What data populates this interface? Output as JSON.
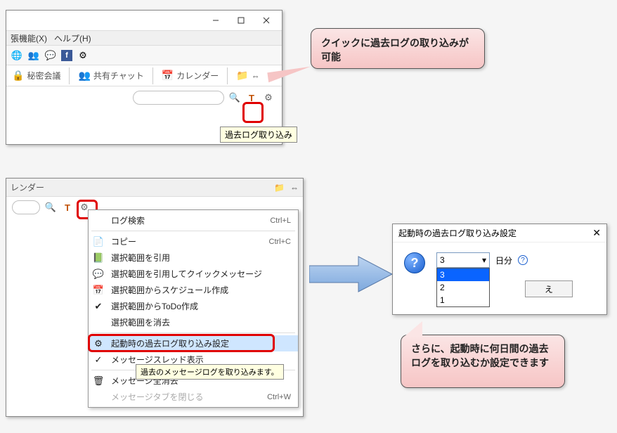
{
  "panel1": {
    "menu_ext": "張機能(X)",
    "menu_help": "ヘルプ(H)",
    "tb_secret": "秘密会議",
    "tb_sharedchat": "共有チャット",
    "tb_calendar": "カレンダー",
    "tooltip_import": "過去ログ取り込み"
  },
  "callout1": {
    "text": "クイックに過去ログの取り込みが可能"
  },
  "panel2": {
    "tb_calendar": "レンダー",
    "ctx": [
      {
        "label": "ログ検索",
        "shortcut": "Ctrl+L",
        "ico": ""
      },
      {
        "sep": true
      },
      {
        "label": "コピー",
        "shortcut": "Ctrl+C",
        "ico": "📄"
      },
      {
        "label": "選択範囲を引用",
        "ico": "📗"
      },
      {
        "label": "選択範囲を引用してクイックメッセージ",
        "ico": "💬"
      },
      {
        "label": "選択範囲からスケジュール作成",
        "ico": "📅"
      },
      {
        "label": "選択範囲からToDo作成",
        "ico": "✔"
      },
      {
        "label": "選択範囲を消去",
        "ico": ""
      },
      {
        "sep": true
      },
      {
        "label": "起動時の過去ログ取り込み設定",
        "hl": true,
        "ico": "⚙"
      },
      {
        "label": "メッセージスレッド表示",
        "checked": true,
        "ico": "✓"
      },
      {
        "sep": true
      },
      {
        "label": "メッセージ全消去",
        "ico": "🗑"
      },
      {
        "label": "メッセージタブを閉じる",
        "shortcut": "Ctrl+W",
        "disabled": true,
        "ico": ""
      }
    ],
    "tooltip_hint": "過去のメッセージログを取り込みます。"
  },
  "panel3": {
    "title": "起動時の過去ログ取り込み設定",
    "selected": "3",
    "options": [
      "3",
      "2",
      "1"
    ],
    "unit": "日分",
    "ok_partial": "え"
  },
  "callout2": {
    "text": "さらに、起動時に何日間の過去ログを取り込むか設定できます"
  }
}
